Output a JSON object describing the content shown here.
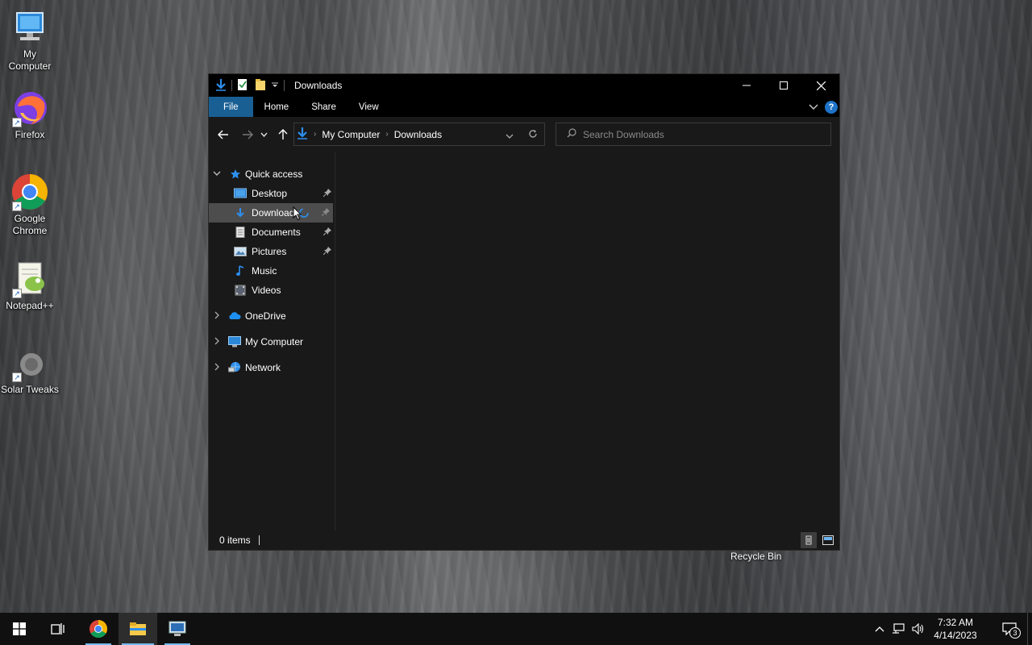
{
  "desktop": {
    "icons": [
      {
        "label_line1": "My",
        "label_line2": "Computer",
        "icon": "monitor-icon"
      },
      {
        "label_line1": "Firefox",
        "label_line2": "",
        "icon": "firefox-icon"
      },
      {
        "label_line1": "Google",
        "label_line2": "Chrome",
        "icon": "chrome-icon"
      },
      {
        "label_line1": "Notepad++",
        "label_line2": "",
        "icon": "notepadpp-icon"
      },
      {
        "label_line1": "Solar Tweaks",
        "label_line2": "",
        "icon": "solar-tweaks-icon"
      }
    ],
    "recycle_bin_label": "Recycle Bin"
  },
  "window": {
    "title": "Downloads",
    "controls": {
      "minimize": "minimize-icon",
      "maximize": "maximize-icon",
      "close": "close-icon"
    },
    "ribbon_tabs": [
      "File",
      "Home",
      "Share",
      "View"
    ],
    "help_label": "?",
    "address": {
      "crumbs": [
        "My Computer",
        "Downloads"
      ]
    },
    "search": {
      "placeholder": "Search Downloads"
    },
    "nav_pane": {
      "quick_access_label": "Quick access",
      "quick_items": [
        {
          "label": "Desktop",
          "pinned": true,
          "icon": "desktop-folder-icon"
        },
        {
          "label": "Downloads",
          "pinned": true,
          "selected": true,
          "icon": "download-arrow-icon"
        },
        {
          "label": "Documents",
          "pinned": true,
          "icon": "documents-icon"
        },
        {
          "label": "Pictures",
          "pinned": true,
          "icon": "pictures-icon"
        },
        {
          "label": "Music",
          "pinned": false,
          "icon": "music-note-icon"
        },
        {
          "label": "Videos",
          "pinned": false,
          "icon": "videos-icon"
        }
      ],
      "roots": [
        {
          "label": "OneDrive",
          "icon": "cloud-icon"
        },
        {
          "label": "My Computer",
          "icon": "monitor-icon"
        },
        {
          "label": "Network",
          "icon": "network-icon"
        }
      ]
    },
    "status": {
      "item_count": "0 items"
    }
  },
  "taskbar": {
    "clock_time": "7:32 AM",
    "clock_date": "4/14/2023",
    "notification_count": "3",
    "accent_color": "#76b9ed"
  },
  "colors": {
    "ribbon_file_tab": "#1a5f94",
    "window_bg": "#191919",
    "selected_item": "#4d4d4d"
  }
}
